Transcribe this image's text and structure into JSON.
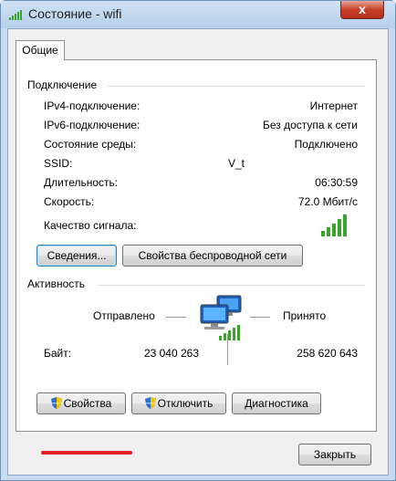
{
  "window": {
    "title": "Состояние - wifi",
    "close_label": "x"
  },
  "tabs": [
    {
      "label": "Общие"
    }
  ],
  "connection": {
    "group_label": "Подключение",
    "rows": [
      {
        "label": "IPv4-подключение:",
        "value": "Интернет"
      },
      {
        "label": "IPv6-подключение:",
        "value": "Без доступа к сети"
      },
      {
        "label": "Состояние среды:",
        "value": "Подключено"
      },
      {
        "label": "SSID:",
        "value": "V_t"
      },
      {
        "label": "Длительность:",
        "value": "06:30:59"
      },
      {
        "label": "Скорость:",
        "value": "72.0 Мбит/с"
      }
    ],
    "signal_label": "Качество сигнала:",
    "signal_bars": 5,
    "details_button": "Сведения...",
    "wireless_props_button": "Свойства беспроводной сети"
  },
  "activity": {
    "group_label": "Активность",
    "sent_label": "Отправлено",
    "received_label": "Принято",
    "bytes_label": "Байт:",
    "bytes_sent": "23 040 263",
    "bytes_received": "258 620 643"
  },
  "buttons": {
    "properties": "Свойства",
    "disconnect": "Отключить",
    "diagnostics": "Диагностика",
    "close": "Закрыть"
  },
  "colors": {
    "signal_green": "#3aa52b",
    "highlight_red": "#e5202a"
  }
}
